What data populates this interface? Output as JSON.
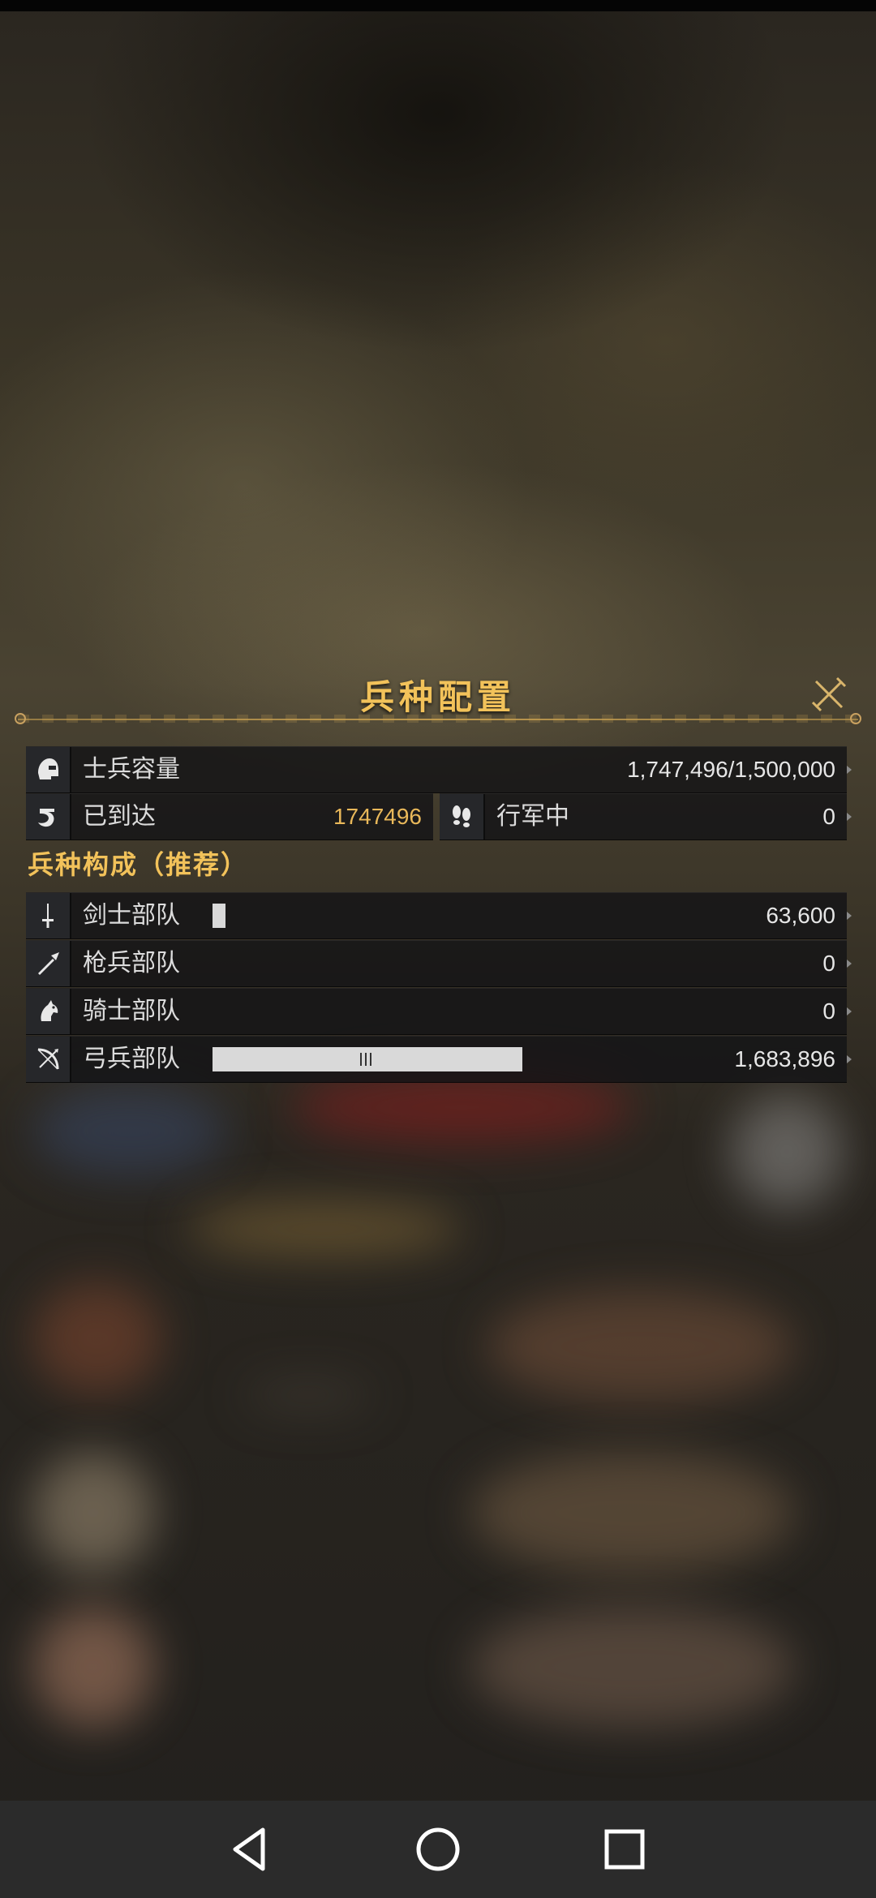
{
  "panel": {
    "title": "兵种配置"
  },
  "summary": {
    "capacity_label": "士兵容量",
    "capacity_value": "1,747,496/1,500,000",
    "arrived_label": "已到达",
    "arrived_value": "1747496",
    "marching_label": "行军中",
    "marching_value": "0"
  },
  "composition": {
    "title": "兵种构成（推荐）",
    "units": [
      {
        "label": "剑士部队",
        "value": "63,600",
        "icon": "sword-icon"
      },
      {
        "label": "枪兵部队",
        "value": "0",
        "icon": "spear-icon"
      },
      {
        "label": "骑士部队",
        "value": "0",
        "icon": "horse-icon"
      },
      {
        "label": "弓兵部队",
        "value": "1,683,896",
        "icon": "bow-icon"
      }
    ]
  },
  "colors": {
    "accent_gold": "#f2c25a",
    "value_gold": "#e9b85a",
    "row_bg": "#141416"
  },
  "nav": {
    "back_icon": "triangle-back-icon",
    "home_icon": "circle-home-icon",
    "recent_icon": "square-recent-icon"
  }
}
